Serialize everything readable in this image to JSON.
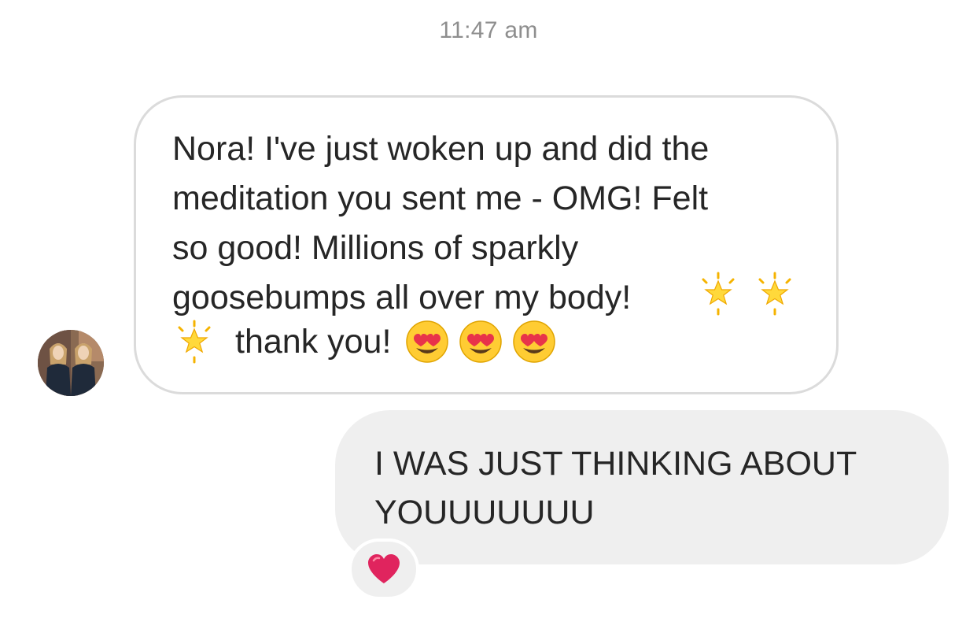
{
  "conversation": {
    "timestamp": "11:47 am"
  },
  "incoming_message": {
    "text": "Nora! I've just woken up and did the\nmeditation you sent me - OMG! Felt\nso good! Millions of sparkly\ngoosebumps all over my body!",
    "trailing_text": "thank you!",
    "emojis_after_body": [
      "glowing-star",
      "glowing-star"
    ],
    "emojis_line5_start": [
      "glowing-star"
    ],
    "emojis_after_thanks": [
      "heart-eyes",
      "heart-eyes",
      "heart-eyes"
    ]
  },
  "outgoing_message": {
    "text": "I WAS JUST THINKING ABOUT\nYOUUUUUUU",
    "reaction": "red-heart"
  },
  "colors": {
    "incoming_border": "#dbdbdb",
    "outgoing_bg": "#efefef",
    "text": "#262626",
    "timestamp": "#8e8e8e",
    "heart": "#e0245e"
  }
}
